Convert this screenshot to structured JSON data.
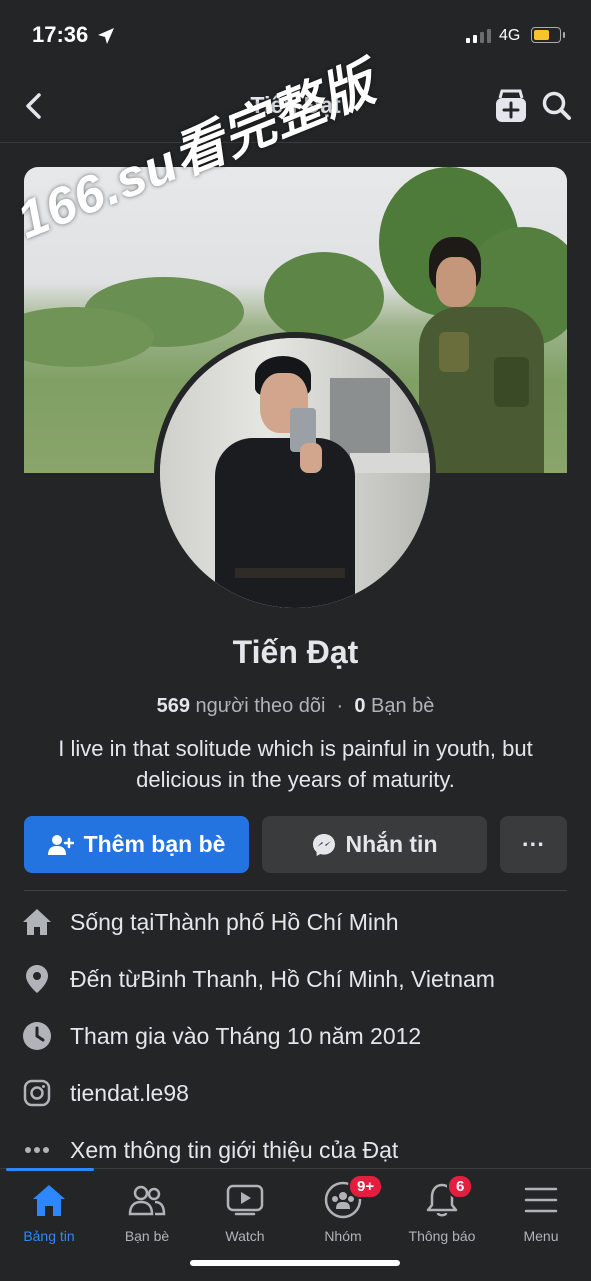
{
  "status_bar": {
    "time": "17:36",
    "network": "4G"
  },
  "header": {
    "title": "Tiến Đạt"
  },
  "watermark": "166.su看完整版",
  "profile": {
    "name": "Tiến Đạt",
    "followers_count": "569",
    "followers_label": "người theo dõi",
    "friends_count": "0",
    "friends_label": "Bạn bè",
    "bio": "I live in that solitude which is painful in youth, but delicious in the years of maturity."
  },
  "actions": {
    "add_friend": "Thêm bạn bè",
    "message": "Nhắn tin",
    "more": "···"
  },
  "info": [
    {
      "icon": "home-icon",
      "prefix": "Sống tại ",
      "value": "Thành phố Hồ Chí Minh"
    },
    {
      "icon": "location-pin-icon",
      "prefix": "Đến từ ",
      "value": "Binh Thanh, Hồ Chí Minh, Vietnam"
    },
    {
      "icon": "clock-icon",
      "prefix": "Tham gia vào Tháng 10 năm 2012",
      "value": ""
    },
    {
      "icon": "instagram-icon",
      "prefix": "tiendat.le98",
      "value": ""
    },
    {
      "icon": "more-dots-icon",
      "prefix": "Xem thông tin giới thiệu của Đạt",
      "value": ""
    }
  ],
  "tabs": [
    {
      "label": "Bảng tin",
      "icon": "home-tab-icon",
      "active": true
    },
    {
      "label": "Bạn bè",
      "icon": "friends-icon"
    },
    {
      "label": "Watch",
      "icon": "watch-icon"
    },
    {
      "label": "Nhóm",
      "icon": "groups-icon",
      "badge": "9+"
    },
    {
      "label": "Thông báo",
      "icon": "bell-icon",
      "badge": "6"
    },
    {
      "label": "Menu",
      "icon": "menu-icon"
    }
  ],
  "colors": {
    "accent": "#2374e1",
    "background": "#242526",
    "badge": "#e41e3f"
  }
}
